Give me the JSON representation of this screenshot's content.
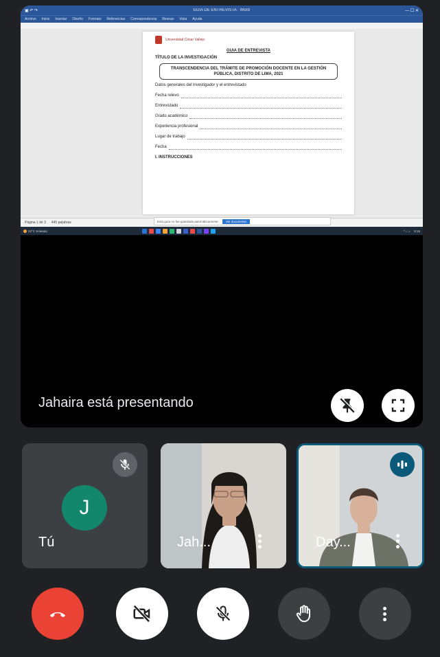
{
  "presentation": {
    "presenter_label": "Jahaira está presentando",
    "word": {
      "window_title": "GUIA DE ENTREVISTA · Word",
      "ribbon_tabs": [
        "Archivo",
        "Inicio",
        "Insertar",
        "Diseño",
        "Formato",
        "Referencias",
        "Correspondencia",
        "Revisar",
        "Vista",
        "Ayuda"
      ],
      "logo_text": "Universidad César Vallejo",
      "doc_title": "GUIA DE ENTREVISTA",
      "doc_heading": "TÍTULO DE LA INVESTIGACIÓN",
      "box_text": "TRANSCENDENCIA DEL TRÁMITE DE PROMOCIÓN DOCENTE EN LA GESTIÓN PÚBLICA, DISTRITO DE LIMA, 2021",
      "fields": [
        "Fecha relevo",
        "Entrevistado",
        "Grado académico",
        "Experiencia profesional",
        "Lugar de trabajo",
        "Fecha"
      ],
      "section": "Datos generales del investigador y el entrevistado",
      "instructions": "I. INSTRUCCIONES",
      "status_left": "Página 1 de 3",
      "status_words": "445 palabras",
      "notification_text": "Esta guía no fue guardada automáticamente",
      "notification_button": "Ver documento",
      "taskbar_weather": "22°C Soleado",
      "taskbar_time": "9:16"
    }
  },
  "tiles": {
    "self": {
      "name": "Tú",
      "avatar_letter": "J"
    },
    "jahaira": {
      "name": "Jah..."
    },
    "dayan": {
      "name": "Day..."
    }
  },
  "icons": {
    "unpin": "unpin-icon",
    "fullscreen": "fullscreen-icon",
    "mic_off": "mic-off-icon",
    "speaking": "speaking-icon",
    "more": "more-vert-icon",
    "hangup": "call-end-icon",
    "camera_off": "camera-off-icon",
    "raise_hand": "hand-icon"
  },
  "colors": {
    "background": "#202124",
    "hangup": "#ea4335",
    "avatar": "#13876b",
    "active_speaker": "#0b5a7a"
  }
}
